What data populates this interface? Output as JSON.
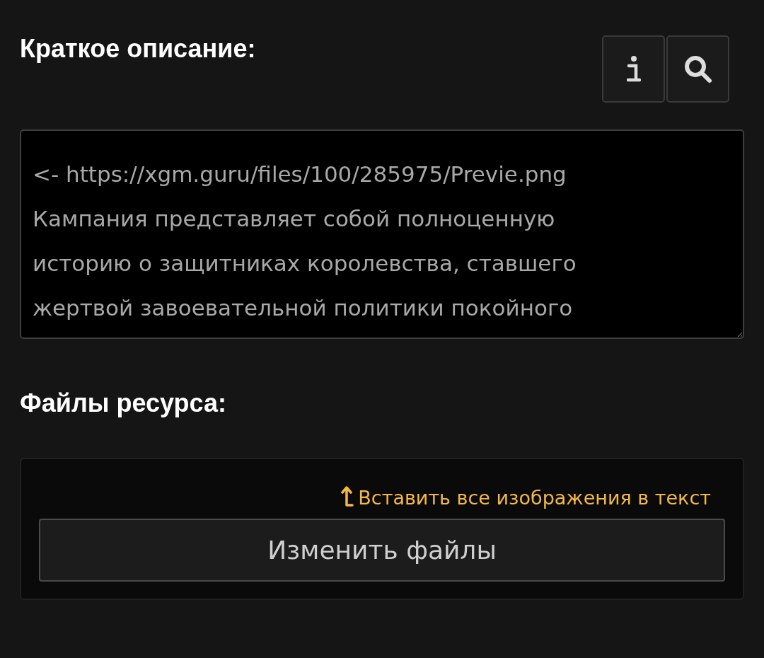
{
  "description": {
    "label": "Краткое описание:",
    "value": "<- https://xgm.guru/files/100/285975/Previe.png\nКампания представляет собой полноценную\nисторию о защитниках королевства, ставшего\nжертвой завоевательной политики покойного"
  },
  "files": {
    "label": "Файлы ресурса:",
    "insert_link": "Вставить все изображения в текст",
    "button": "Изменить файлы"
  }
}
